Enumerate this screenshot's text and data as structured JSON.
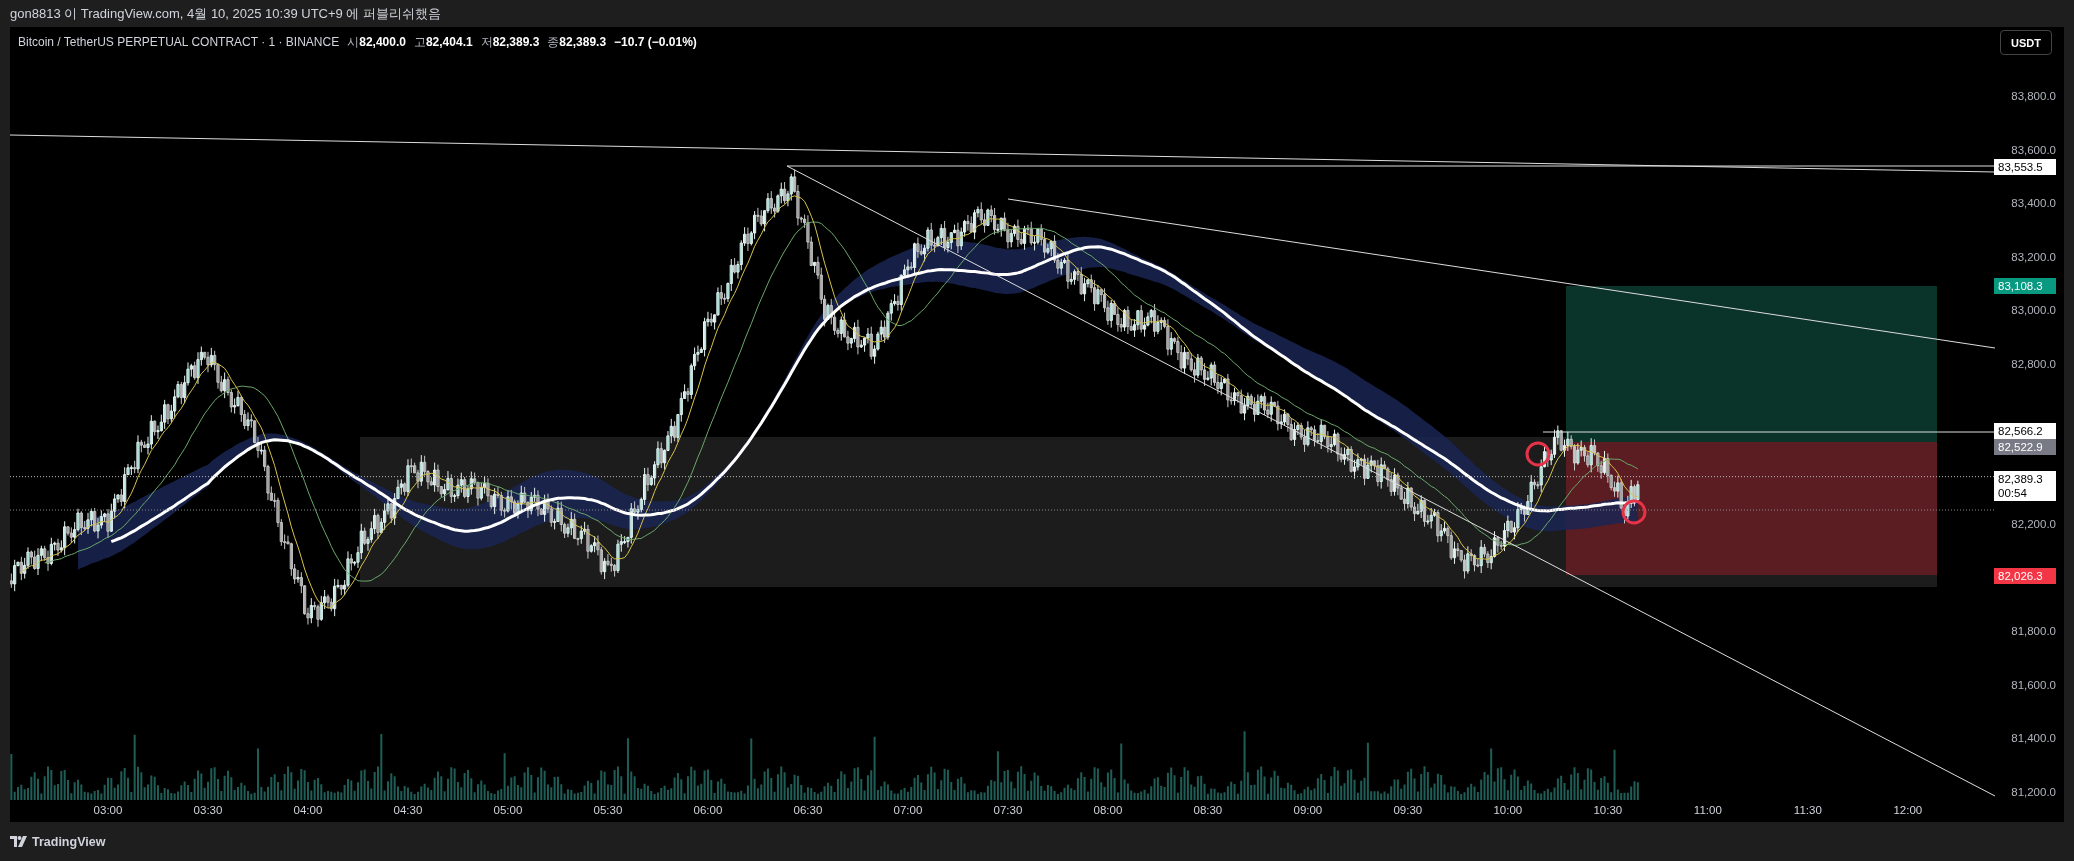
{
  "attribution": "gon8813 이 TradingView.com, 4월 10, 2025 10:39 UTC+9 에 퍼블리쉬했음",
  "legend": {
    "symbol": "Bitcoin / TetherUS PERPETUAL CONTRACT · 1 · BINANCE",
    "ohlc": [
      {
        "label": "시",
        "value": "82,400.0"
      },
      {
        "label": "고",
        "value": "82,404.1"
      },
      {
        "label": "저",
        "value": "82,389.3"
      },
      {
        "label": "종",
        "value": "82,389.3"
      }
    ],
    "change": "−10.7 (−0.01%)"
  },
  "currency_button": "USDT",
  "price_axis": {
    "ticks": [
      "83,800.0",
      "83,600.0",
      "83,400.0",
      "83,200.0",
      "83,000.0",
      "82,800.0",
      "82,200.0",
      "81,800.0",
      "81,600.0",
      "81,400.0",
      "81,200.0"
    ],
    "markers": [
      {
        "kind": "line",
        "text": "83,553.5"
      },
      {
        "kind": "target",
        "text": "83,108.3"
      },
      {
        "kind": "line",
        "text": "82,566.2"
      },
      {
        "kind": "entry",
        "text": "82,522.9"
      },
      {
        "kind": "last",
        "text": "82,389.3",
        "countdown": "00:54"
      },
      {
        "kind": "stop",
        "text": "82,026.3"
      }
    ]
  },
  "time_axis": [
    "03:00",
    "03:30",
    "04:00",
    "04:30",
    "05:00",
    "05:30",
    "06:00",
    "06:30",
    "07:00",
    "07:30",
    "08:00",
    "08:30",
    "09:00",
    "09:30",
    "10:00",
    "10:30",
    "11:00",
    "11:30",
    "12:00"
  ],
  "brand": "TradingView"
}
